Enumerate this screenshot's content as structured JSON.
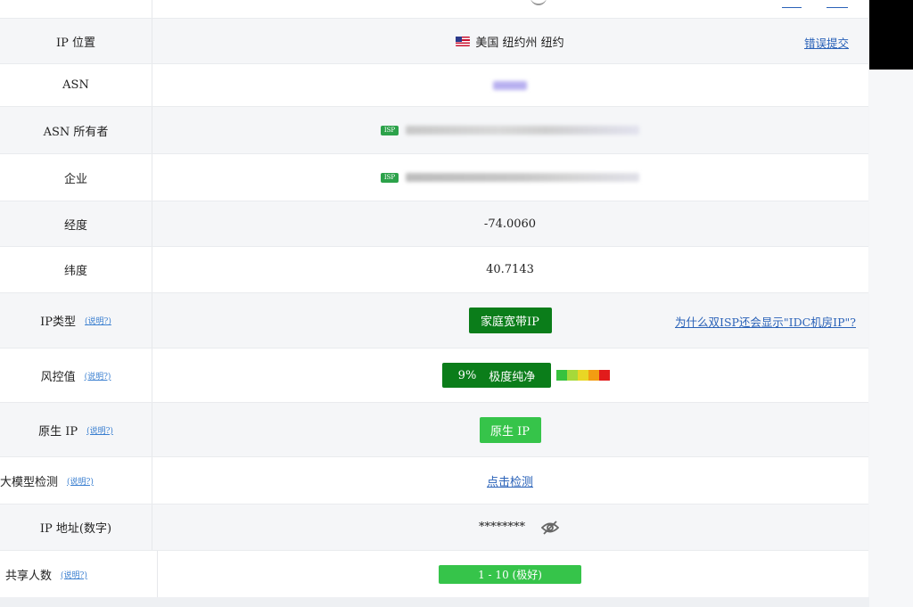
{
  "rows": {
    "ip_location": {
      "label": "IP 位置",
      "value": "美国 纽约州 纽约",
      "action": "错误提交"
    },
    "asn": {
      "label": "ASN"
    },
    "asn_owner": {
      "label": "ASN 所有者",
      "badge": "ISP"
    },
    "company": {
      "label": "企业",
      "badge": "ISP"
    },
    "longitude": {
      "label": "经度",
      "value": "-74.0060"
    },
    "latitude": {
      "label": "纬度",
      "value": "40.7143"
    },
    "ip_type": {
      "label": "IP类型",
      "help": "(说明?)",
      "value": "家庭宽带IP",
      "link": "为什么双ISP还会显示\"IDC机房IP\"?"
    },
    "risk": {
      "label": "风控值",
      "help": "(说明?)",
      "percent": "9%",
      "level": "极度纯净",
      "score_fraction": 0.09
    },
    "native_ip": {
      "label": "原生 IP",
      "help": "(说明?)",
      "value": "原生 IP"
    },
    "llm_detect": {
      "label": "大模型检测",
      "help": "(说明?)",
      "value": "点击检测"
    },
    "ip_numeric": {
      "label": "IP 地址(数字)",
      "value": "********"
    },
    "shared_users": {
      "label": "共享人数",
      "help": "(说明?)",
      "value": "1 - 10 (极好)"
    }
  },
  "icons": {
    "flag": "us-flag-icon",
    "eye": "eye-slash-icon"
  },
  "colors": {
    "green_dark": "#0b7d1a",
    "green_bright": "#36c44a",
    "link": "#2a62b8",
    "risk_scale": [
      "#38c23e",
      "#a6d93a",
      "#e9d625",
      "#f39c12",
      "#e21b1b"
    ]
  }
}
